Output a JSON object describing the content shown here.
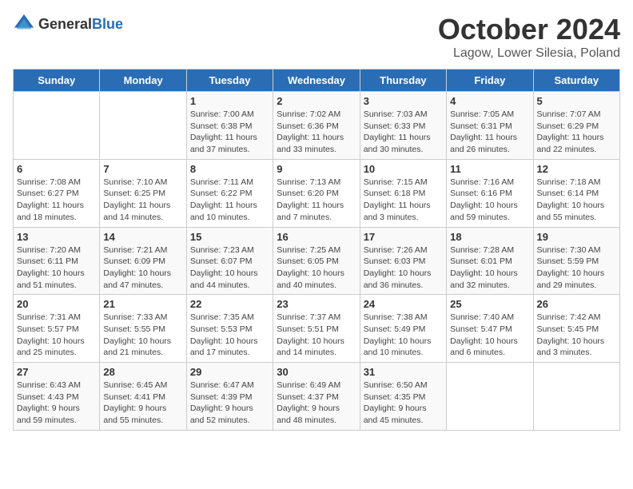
{
  "logo": {
    "general": "General",
    "blue": "Blue"
  },
  "title": "October 2024",
  "location": "Lagow, Lower Silesia, Poland",
  "headers": [
    "Sunday",
    "Monday",
    "Tuesday",
    "Wednesday",
    "Thursday",
    "Friday",
    "Saturday"
  ],
  "weeks": [
    [
      {
        "day": "",
        "info": ""
      },
      {
        "day": "",
        "info": ""
      },
      {
        "day": "1",
        "info": "Sunrise: 7:00 AM\nSunset: 6:38 PM\nDaylight: 11 hours\nand 37 minutes."
      },
      {
        "day": "2",
        "info": "Sunrise: 7:02 AM\nSunset: 6:36 PM\nDaylight: 11 hours\nand 33 minutes."
      },
      {
        "day": "3",
        "info": "Sunrise: 7:03 AM\nSunset: 6:33 PM\nDaylight: 11 hours\nand 30 minutes."
      },
      {
        "day": "4",
        "info": "Sunrise: 7:05 AM\nSunset: 6:31 PM\nDaylight: 11 hours\nand 26 minutes."
      },
      {
        "day": "5",
        "info": "Sunrise: 7:07 AM\nSunset: 6:29 PM\nDaylight: 11 hours\nand 22 minutes."
      }
    ],
    [
      {
        "day": "6",
        "info": "Sunrise: 7:08 AM\nSunset: 6:27 PM\nDaylight: 11 hours\nand 18 minutes."
      },
      {
        "day": "7",
        "info": "Sunrise: 7:10 AM\nSunset: 6:25 PM\nDaylight: 11 hours\nand 14 minutes."
      },
      {
        "day": "8",
        "info": "Sunrise: 7:11 AM\nSunset: 6:22 PM\nDaylight: 11 hours\nand 10 minutes."
      },
      {
        "day": "9",
        "info": "Sunrise: 7:13 AM\nSunset: 6:20 PM\nDaylight: 11 hours\nand 7 minutes."
      },
      {
        "day": "10",
        "info": "Sunrise: 7:15 AM\nSunset: 6:18 PM\nDaylight: 11 hours\nand 3 minutes."
      },
      {
        "day": "11",
        "info": "Sunrise: 7:16 AM\nSunset: 6:16 PM\nDaylight: 10 hours\nand 59 minutes."
      },
      {
        "day": "12",
        "info": "Sunrise: 7:18 AM\nSunset: 6:14 PM\nDaylight: 10 hours\nand 55 minutes."
      }
    ],
    [
      {
        "day": "13",
        "info": "Sunrise: 7:20 AM\nSunset: 6:11 PM\nDaylight: 10 hours\nand 51 minutes."
      },
      {
        "day": "14",
        "info": "Sunrise: 7:21 AM\nSunset: 6:09 PM\nDaylight: 10 hours\nand 47 minutes."
      },
      {
        "day": "15",
        "info": "Sunrise: 7:23 AM\nSunset: 6:07 PM\nDaylight: 10 hours\nand 44 minutes."
      },
      {
        "day": "16",
        "info": "Sunrise: 7:25 AM\nSunset: 6:05 PM\nDaylight: 10 hours\nand 40 minutes."
      },
      {
        "day": "17",
        "info": "Sunrise: 7:26 AM\nSunset: 6:03 PM\nDaylight: 10 hours\nand 36 minutes."
      },
      {
        "day": "18",
        "info": "Sunrise: 7:28 AM\nSunset: 6:01 PM\nDaylight: 10 hours\nand 32 minutes."
      },
      {
        "day": "19",
        "info": "Sunrise: 7:30 AM\nSunset: 5:59 PM\nDaylight: 10 hours\nand 29 minutes."
      }
    ],
    [
      {
        "day": "20",
        "info": "Sunrise: 7:31 AM\nSunset: 5:57 PM\nDaylight: 10 hours\nand 25 minutes."
      },
      {
        "day": "21",
        "info": "Sunrise: 7:33 AM\nSunset: 5:55 PM\nDaylight: 10 hours\nand 21 minutes."
      },
      {
        "day": "22",
        "info": "Sunrise: 7:35 AM\nSunset: 5:53 PM\nDaylight: 10 hours\nand 17 minutes."
      },
      {
        "day": "23",
        "info": "Sunrise: 7:37 AM\nSunset: 5:51 PM\nDaylight: 10 hours\nand 14 minutes."
      },
      {
        "day": "24",
        "info": "Sunrise: 7:38 AM\nSunset: 5:49 PM\nDaylight: 10 hours\nand 10 minutes."
      },
      {
        "day": "25",
        "info": "Sunrise: 7:40 AM\nSunset: 5:47 PM\nDaylight: 10 hours\nand 6 minutes."
      },
      {
        "day": "26",
        "info": "Sunrise: 7:42 AM\nSunset: 5:45 PM\nDaylight: 10 hours\nand 3 minutes."
      }
    ],
    [
      {
        "day": "27",
        "info": "Sunrise: 6:43 AM\nSunset: 4:43 PM\nDaylight: 9 hours\nand 59 minutes."
      },
      {
        "day": "28",
        "info": "Sunrise: 6:45 AM\nSunset: 4:41 PM\nDaylight: 9 hours\nand 55 minutes."
      },
      {
        "day": "29",
        "info": "Sunrise: 6:47 AM\nSunset: 4:39 PM\nDaylight: 9 hours\nand 52 minutes."
      },
      {
        "day": "30",
        "info": "Sunrise: 6:49 AM\nSunset: 4:37 PM\nDaylight: 9 hours\nand 48 minutes."
      },
      {
        "day": "31",
        "info": "Sunrise: 6:50 AM\nSunset: 4:35 PM\nDaylight: 9 hours\nand 45 minutes."
      },
      {
        "day": "",
        "info": ""
      },
      {
        "day": "",
        "info": ""
      }
    ]
  ]
}
